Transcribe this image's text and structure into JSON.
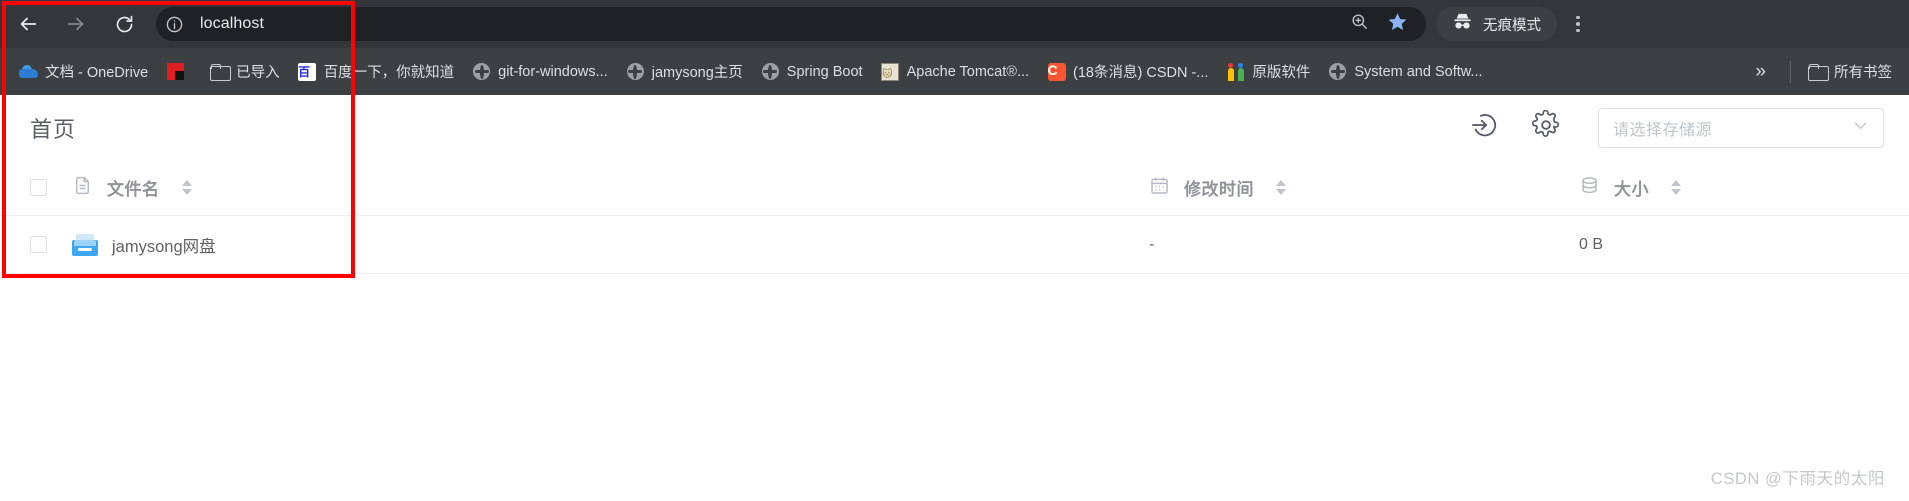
{
  "browser": {
    "nav": {
      "back": "back-arrow",
      "forward": "forward-arrow",
      "reload": "reload"
    },
    "omnibox": {
      "url": "localhost",
      "site_info_icon": "info-circle",
      "zoom_icon": "zoom-search",
      "bookmark_icon": "star-filled"
    },
    "incognito_label": "无痕模式",
    "bookmarks": [
      {
        "label": "文档 - OneDrive",
        "icon": "onedrive-icon"
      },
      {
        "label": "",
        "icon": "lenovo-icon"
      },
      {
        "label": "已导入",
        "icon": "folder-icon"
      },
      {
        "label": "百度一下，你就知道",
        "icon": "baidu-icon"
      },
      {
        "label": "git-for-windows...",
        "icon": "globe-icon"
      },
      {
        "label": "jamysong主页",
        "icon": "globe-icon"
      },
      {
        "label": "Spring Boot",
        "icon": "globe-icon"
      },
      {
        "label": "Apache Tomcat®...",
        "icon": "tomcat-icon"
      },
      {
        "label": "(18条消息) CSDN -...",
        "icon": "csdn-icon"
      },
      {
        "label": "原版软件",
        "icon": "yuanban-icon"
      },
      {
        "label": "System and Softw...",
        "icon": "globe-icon"
      }
    ],
    "bookmarks_overflow": "»",
    "all_bookmarks_label": "所有书签"
  },
  "page": {
    "title": "首页",
    "actions": {
      "login_icon": "login-arrow-icon",
      "settings_icon": "gear-icon"
    },
    "storage_select": {
      "placeholder": "请选择存储源",
      "value": "",
      "chevron": "chevron-down-icon"
    },
    "table": {
      "headers": {
        "name": "文件名",
        "modified": "修改时间",
        "size": "大小"
      },
      "header_icons": {
        "name": "document-icon",
        "modified": "calendar-icon",
        "size": "database-icon"
      },
      "rows": [
        {
          "name": "jamysong网盘",
          "icon": "blue-drive-icon",
          "modified": "-",
          "size": "0 B",
          "checked": false
        }
      ]
    }
  },
  "watermark": "CSDN @下雨天的太阳",
  "colors": {
    "chrome_toolbar": "#35363a",
    "chrome_bookmarks": "#3c4043",
    "omnibox_bg": "#202124",
    "accent_blue": "#3ea7f0",
    "annotation_red": "#fe0000",
    "text_muted": "#909399"
  }
}
